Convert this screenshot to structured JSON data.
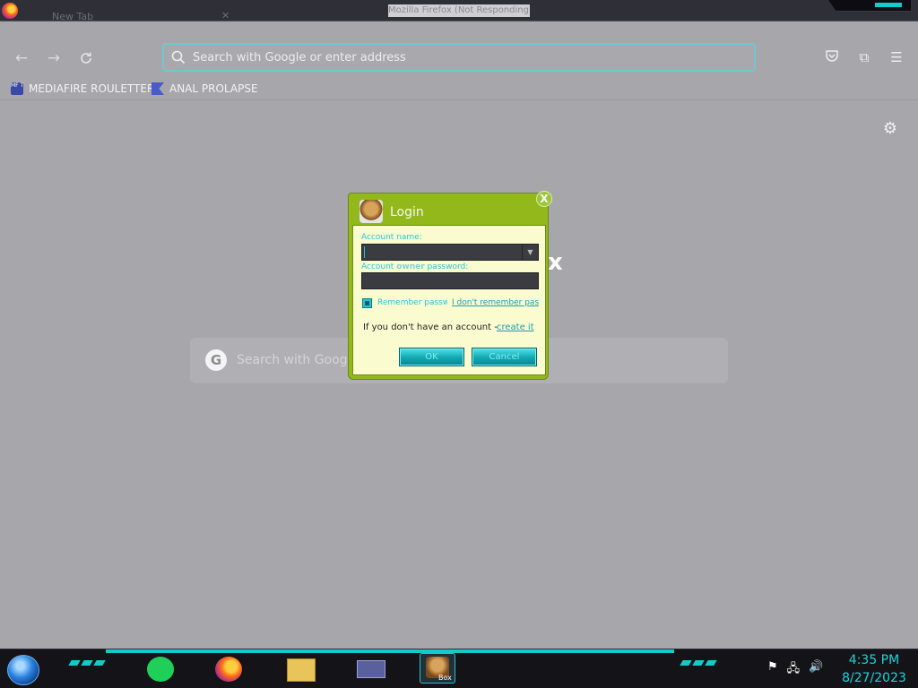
{
  "window": {
    "title": "Mozilla Firefox (Not Responding)",
    "tab_title": "New Tab"
  },
  "toolbar": {
    "url_placeholder": "Search with Google or enter address"
  },
  "bookmarks": [
    {
      "label": "MEDIAFIRE ROULETTER",
      "icon_text": "MF T"
    },
    {
      "label": "ANAL PROLAPSE"
    }
  ],
  "newtab": {
    "search_placeholder": "Search with Googl",
    "logo_fragment": "x"
  },
  "login_dialog": {
    "title": "Login",
    "account_name_label": "Account name:",
    "password_label_pre": "Account ",
    "password_label_bold": "owner",
    "password_label_post": " password:",
    "remember_label": "Remember passw",
    "remember_checked": true,
    "forgot_link": "I don't remember pas",
    "no_account_text": "If you don't have an account -",
    "create_link": "create it",
    "ok_label": "OK",
    "cancel_label": "Cancel",
    "close_label": "X"
  },
  "taskbar": {
    "apps": [
      "spotify-icon",
      "firefox-icon",
      "file-explorer-icon",
      "id-card-icon",
      "beaver-box-icon"
    ],
    "active_app_label": "Box",
    "time": "4:35 PM",
    "date": "8/27/2023"
  },
  "colors": {
    "accent": "#17c9c7",
    "dialog_green": "#93b81b",
    "dialog_panel": "#fbfbd0"
  }
}
